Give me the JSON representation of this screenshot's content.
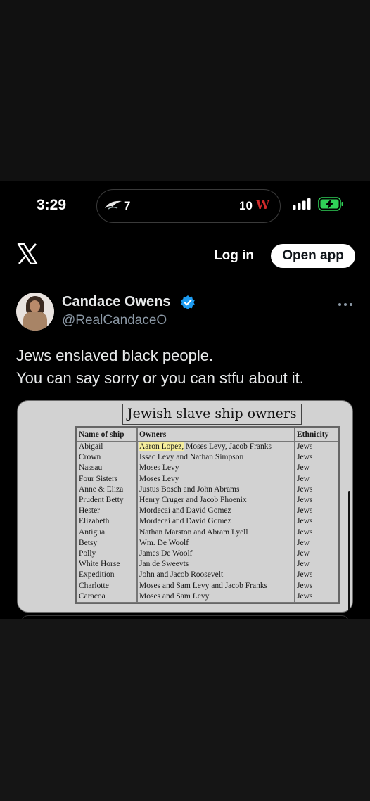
{
  "status_bar": {
    "time": "3:29",
    "live_activity": {
      "left_team_icon": "eagle-icon",
      "left_score": "7",
      "right_score": "10",
      "right_team_logo": "W"
    },
    "icons": [
      "signal-bars-icon",
      "battery-charging-icon"
    ]
  },
  "header": {
    "logo_icon": "x-logo-icon",
    "login_label": "Log in",
    "open_app_label": "Open app"
  },
  "post": {
    "author_name": "Candace Owens",
    "verified_icon": "verified-badge-icon",
    "handle": "@RealCandaceO",
    "more_icon": "more-icon",
    "text_lines": [
      "Jews enslaved black people.",
      "You can say sorry or you can stfu about it."
    ],
    "image": {
      "title": "Jewish slave ship owners",
      "headers": [
        "Name of ship",
        "Owners",
        "Ethnicity"
      ],
      "rows": [
        {
          "ship": "Abigail",
          "owners_highlight": "Aaron Lopez,",
          "owners": " Moses Levy, Jacob Franks",
          "ethnicity": "Jews"
        },
        {
          "ship": "Crown",
          "owners_highlight": "",
          "owners": "Issac Levy and Nathan Simpson",
          "ethnicity": "Jews"
        },
        {
          "ship": "Nassau",
          "owners_highlight": "",
          "owners": "Moses Levy",
          "ethnicity": "Jew"
        },
        {
          "ship": "Four Sisters",
          "owners_highlight": "",
          "owners": "Moses Levy",
          "ethnicity": "Jew"
        },
        {
          "ship": "Anne & Eliza",
          "owners_highlight": "",
          "owners": "Justus Bosch and John Abrams",
          "ethnicity": "Jews"
        },
        {
          "ship": "Prudent Betty",
          "owners_highlight": "",
          "owners": "Henry Cruger and Jacob Phoenix",
          "ethnicity": "Jews"
        },
        {
          "ship": "Hester",
          "owners_highlight": "",
          "owners": "Mordecai and David Gomez",
          "ethnicity": "Jews"
        },
        {
          "ship": "Elizabeth",
          "owners_highlight": "",
          "owners": "Mordecai and David Gomez",
          "ethnicity": "Jews"
        },
        {
          "ship": "Antigua",
          "owners_highlight": "",
          "owners": "Nathan Marston and Abram Lyell",
          "ethnicity": "Jews"
        },
        {
          "ship": "Betsy",
          "owners_highlight": "",
          "owners": "Wm. De Woolf",
          "ethnicity": "Jew"
        },
        {
          "ship": "Polly",
          "owners_highlight": "",
          "owners": "James De Woolf",
          "ethnicity": "Jew"
        },
        {
          "ship": "White Horse",
          "owners_highlight": "",
          "owners": "Jan de Sweevts",
          "ethnicity": "Jew"
        },
        {
          "ship": "Expedition",
          "owners_highlight": "",
          "owners": "John and Jacob Roosevelt",
          "ethnicity": "Jews"
        },
        {
          "ship": "Charlotte",
          "owners_highlight": "",
          "owners": "Moses and Sam Levy and Jacob Franks",
          "ethnicity": "Jews"
        },
        {
          "ship": "Caracoa",
          "owners_highlight": "",
          "owners": "Moses and Sam Levy",
          "ethnicity": "Jews"
        }
      ]
    }
  },
  "colors": {
    "background": "#000000",
    "text_primary": "#e7e9ea",
    "text_secondary": "#8b98a5",
    "verified_blue": "#1d9bf0",
    "battery_green": "#30d158"
  }
}
